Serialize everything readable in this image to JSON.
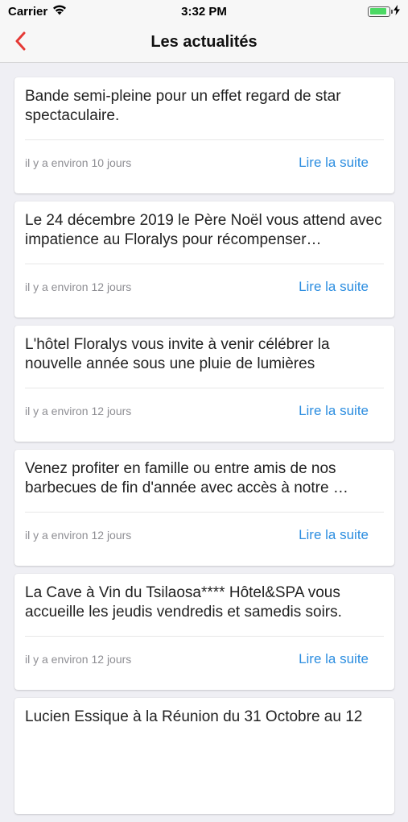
{
  "status_bar": {
    "carrier": "Carrier",
    "time": "3:32 PM",
    "battery_level": 0.9
  },
  "nav": {
    "title": "Les actualités",
    "back_icon": "chevron-left-icon",
    "accent_color": "#e53935"
  },
  "link_color": "#2d8ee0",
  "articles": [
    {
      "text": "Bande semi-pleine pour un effet regard de star spectaculaire.",
      "date": "il y a environ 10 jours",
      "link": "Lire la suite"
    },
    {
      "text": "Le 24 décembre 2019 le Père Noël vous attend avec impatience au Floralys pour récompenser…",
      "date": "il y a environ 12 jours",
      "link": "Lire la suite"
    },
    {
      "text": "L'hôtel Floralys vous invite à venir célébrer la nouvelle année sous une pluie de lumières",
      "date": "il y a environ 12 jours",
      "link": "Lire la suite"
    },
    {
      "text": "Venez profiter en famille ou entre amis de nos barbecues de fin d'année avec accès à notre …",
      "date": "il y a environ 12 jours",
      "link": "Lire la suite"
    },
    {
      "text": "La Cave à Vin du Tsilaosa**** Hôtel&SPA  vous accueille les jeudis vendredis et samedis soirs.",
      "date": "il y a environ 12 jours",
      "link": "Lire la suite"
    },
    {
      "text": "Lucien Essique à la Réunion du 31 Octobre au 12",
      "date": "",
      "link": ""
    }
  ]
}
